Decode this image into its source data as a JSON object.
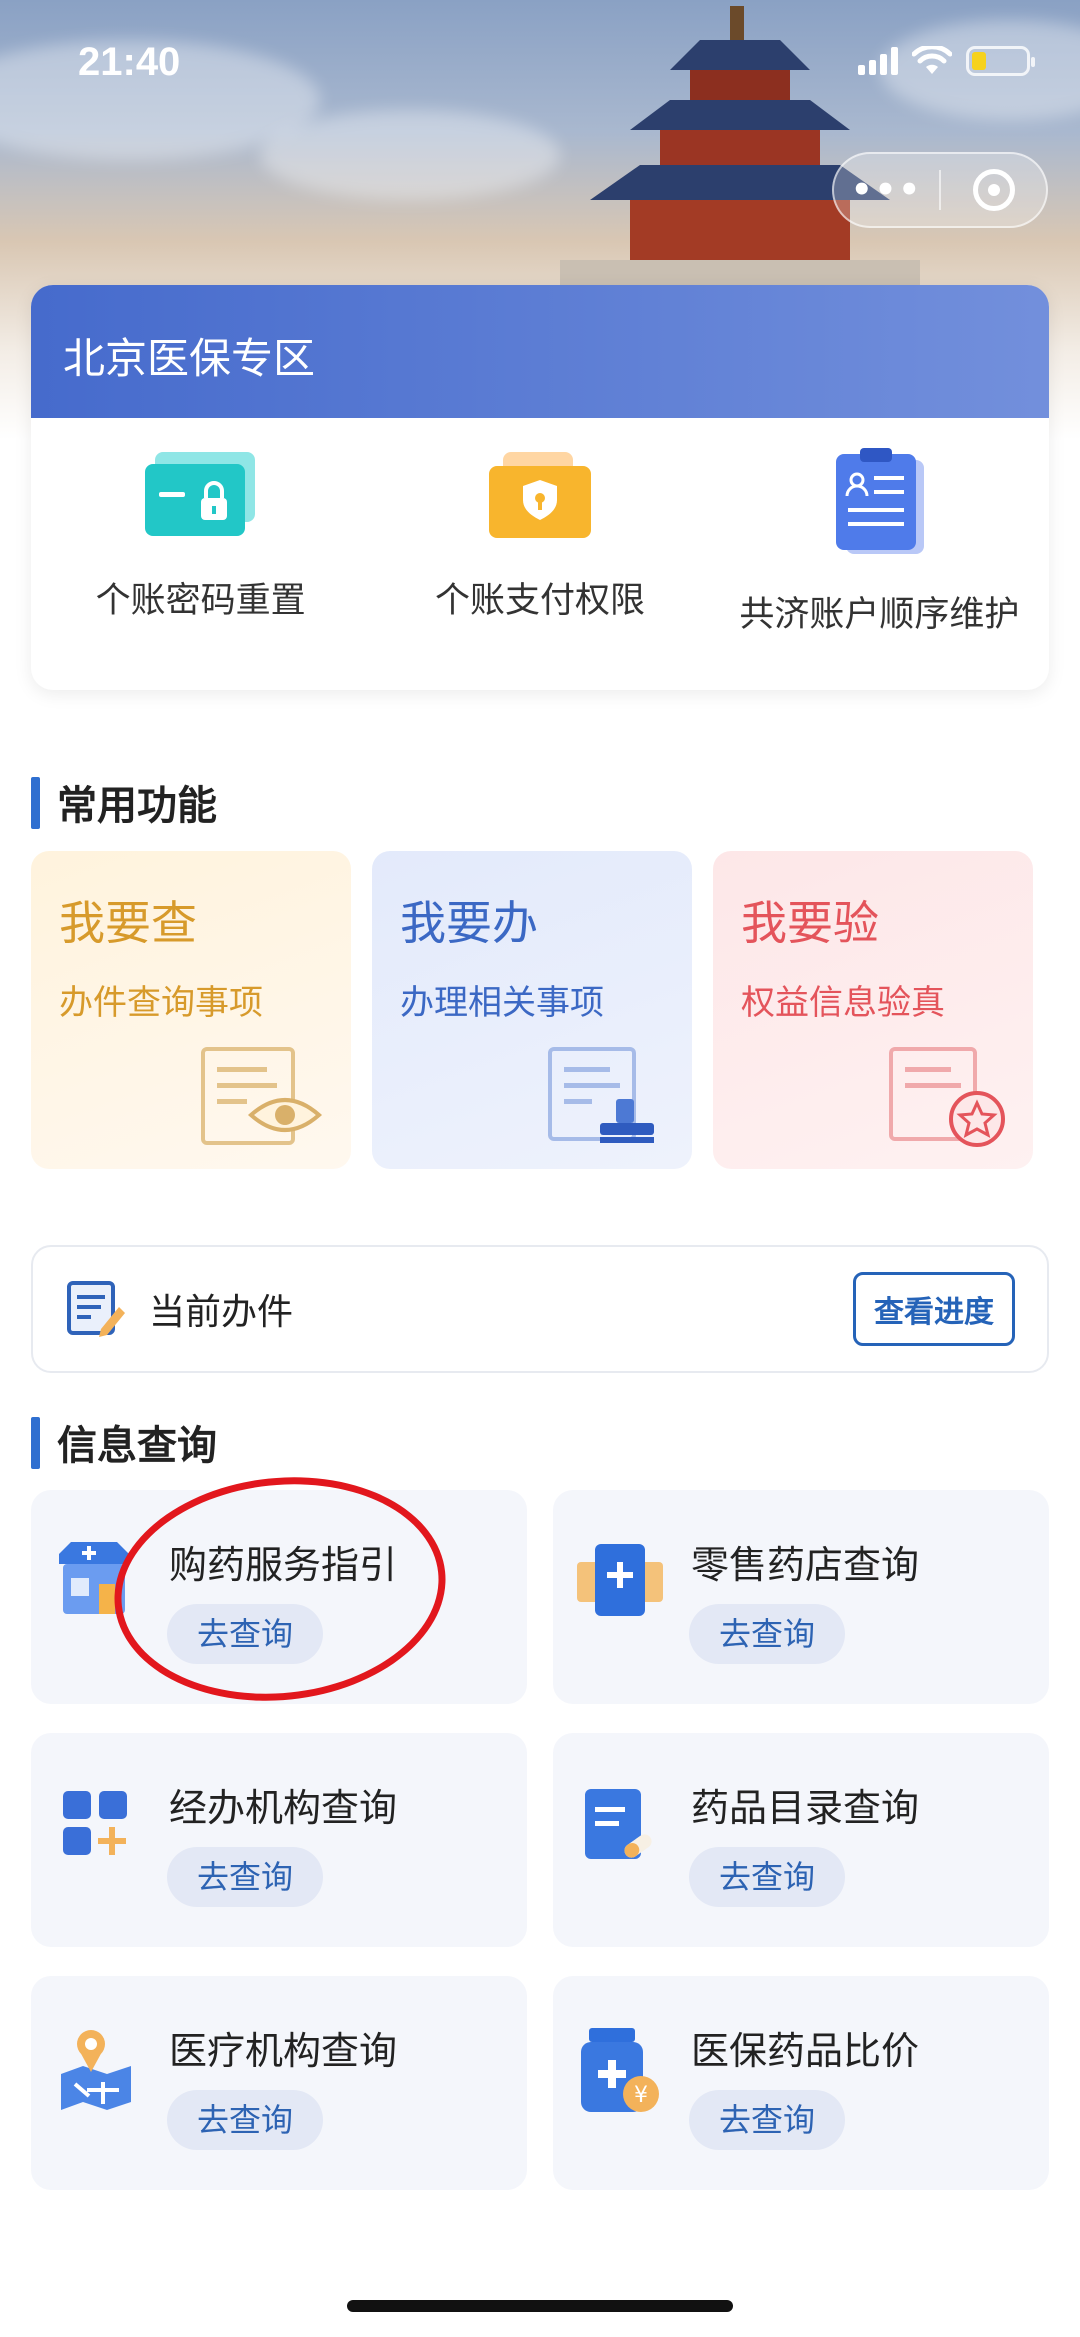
{
  "status_bar": {
    "time": "21:40"
  },
  "capsule": {
    "more_label": "•••"
  },
  "zone": {
    "title": "北京医保专区",
    "items": [
      {
        "label": "个账密码重置",
        "icon": "card-lock-icon"
      },
      {
        "label": "个账支付权限",
        "icon": "wallet-shield-icon"
      },
      {
        "label": "共济账户顺序维护",
        "icon": "clipboard-user-icon"
      }
    ]
  },
  "common": {
    "title": "常用功能",
    "cards": [
      {
        "title": "我要查",
        "subtitle": "办件查询事项",
        "icon": "document-eye-icon"
      },
      {
        "title": "我要办",
        "subtitle": "办理相关事项",
        "icon": "document-stamp-icon"
      },
      {
        "title": "我要验",
        "subtitle": "权益信息验真",
        "icon": "document-star-icon"
      }
    ]
  },
  "current": {
    "label": "当前办件",
    "button": "查看进度"
  },
  "info": {
    "title": "信息查询",
    "items": [
      {
        "title": "购药服务指引",
        "button": "去查询",
        "icon": "pharmacy-store-icon"
      },
      {
        "title": "零售药店查询",
        "button": "去查询",
        "icon": "medkit-plus-icon"
      },
      {
        "title": "经办机构查询",
        "button": "去查询",
        "icon": "grid-plus-icon"
      },
      {
        "title": "药品目录查询",
        "button": "去查询",
        "icon": "clipboard-pill-icon"
      },
      {
        "title": "医疗机构查询",
        "button": "去查询",
        "icon": "map-pin-icon"
      },
      {
        "title": "医保药品比价",
        "button": "去查询",
        "icon": "medicine-bottle-yuan-icon"
      }
    ]
  },
  "colors": {
    "accent": "#2f6fd0",
    "query_orange": "#d79a2b",
    "handle_blue": "#3b68c4",
    "verify_red": "#e4545b",
    "annotation_red": "#e2171d"
  }
}
